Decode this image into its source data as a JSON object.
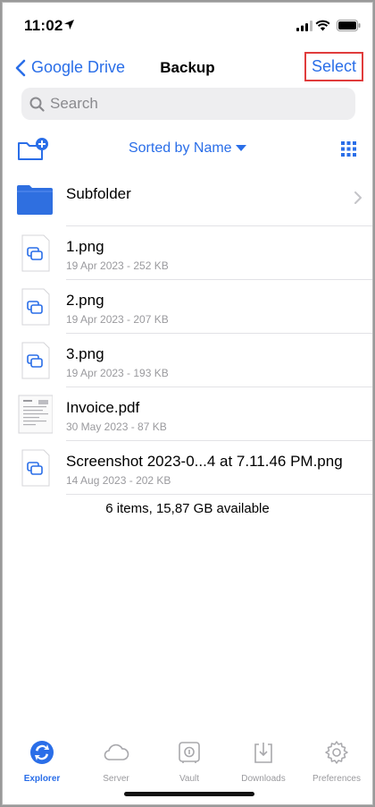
{
  "status_bar": {
    "time": "11:02"
  },
  "nav": {
    "back_label": "Google Drive",
    "title": "Backup",
    "select_label": "Select"
  },
  "search": {
    "placeholder": "Search"
  },
  "toolbar": {
    "sort_label": "Sorted by Name"
  },
  "items": [
    {
      "name": "Subfolder",
      "kind": "folder",
      "icon": "folder-icon"
    },
    {
      "name": "1.png",
      "meta": "19 Apr 2023 - 252 KB",
      "kind": "image",
      "icon": "image-file-icon"
    },
    {
      "name": "2.png",
      "meta": "19 Apr 2023 - 207 KB",
      "kind": "image",
      "icon": "image-file-icon"
    },
    {
      "name": "3.png",
      "meta": "19 Apr 2023 - 193 KB",
      "kind": "image",
      "icon": "image-file-icon"
    },
    {
      "name": "Invoice.pdf",
      "meta": "30 May 2023 - 87 KB",
      "kind": "pdf",
      "icon": "pdf-thumbnail-icon"
    },
    {
      "name": "Screenshot 2023-0...4 at 7.11.46 PM.png",
      "meta": "14 Aug 2023 - 202 KB",
      "kind": "image",
      "icon": "image-file-icon"
    }
  ],
  "footer": {
    "info": "6 items, 15,87 GB available"
  },
  "tabs": [
    {
      "label": "Explorer",
      "icon": "explorer-icon",
      "active": true
    },
    {
      "label": "Server",
      "icon": "cloud-icon",
      "active": false
    },
    {
      "label": "Vault",
      "icon": "vault-icon",
      "active": false
    },
    {
      "label": "Downloads",
      "icon": "download-icon",
      "active": false
    },
    {
      "label": "Preferences",
      "icon": "gear-icon",
      "active": false
    }
  ],
  "colors": {
    "accent": "#2a6ee8",
    "highlight_border": "#e03c3c",
    "folder": "#2f6fe0",
    "secondary_text": "#9a9a9e"
  }
}
